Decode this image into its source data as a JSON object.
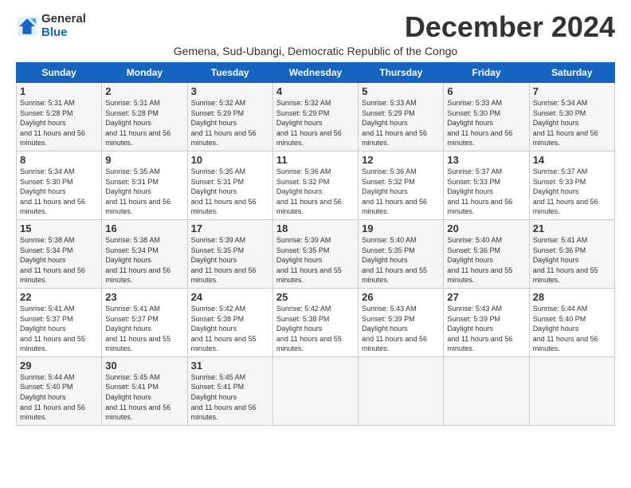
{
  "logo": {
    "line1": "General",
    "line2": "Blue"
  },
  "title": "December 2024",
  "subtitle": "Gemena, Sud-Ubangi, Democratic Republic of the Congo",
  "days_header": [
    "Sunday",
    "Monday",
    "Tuesday",
    "Wednesday",
    "Thursday",
    "Friday",
    "Saturday"
  ],
  "weeks": [
    [
      {
        "day": "1",
        "sunrise": "5:31 AM",
        "sunset": "5:28 PM",
        "daylight": "11 hours and 56 minutes."
      },
      {
        "day": "2",
        "sunrise": "5:31 AM",
        "sunset": "5:28 PM",
        "daylight": "11 hours and 56 minutes."
      },
      {
        "day": "3",
        "sunrise": "5:32 AM",
        "sunset": "5:29 PM",
        "daylight": "11 hours and 56 minutes."
      },
      {
        "day": "4",
        "sunrise": "5:32 AM",
        "sunset": "5:29 PM",
        "daylight": "11 hours and 56 minutes."
      },
      {
        "day": "5",
        "sunrise": "5:33 AM",
        "sunset": "5:29 PM",
        "daylight": "11 hours and 56 minutes."
      },
      {
        "day": "6",
        "sunrise": "5:33 AM",
        "sunset": "5:30 PM",
        "daylight": "11 hours and 56 minutes."
      },
      {
        "day": "7",
        "sunrise": "5:34 AM",
        "sunset": "5:30 PM",
        "daylight": "11 hours and 56 minutes."
      }
    ],
    [
      {
        "day": "8",
        "sunrise": "5:34 AM",
        "sunset": "5:30 PM",
        "daylight": "11 hours and 56 minutes."
      },
      {
        "day": "9",
        "sunrise": "5:35 AM",
        "sunset": "5:31 PM",
        "daylight": "11 hours and 56 minutes."
      },
      {
        "day": "10",
        "sunrise": "5:35 AM",
        "sunset": "5:31 PM",
        "daylight": "11 hours and 56 minutes."
      },
      {
        "day": "11",
        "sunrise": "5:36 AM",
        "sunset": "5:32 PM",
        "daylight": "11 hours and 56 minutes."
      },
      {
        "day": "12",
        "sunrise": "5:36 AM",
        "sunset": "5:32 PM",
        "daylight": "11 hours and 56 minutes."
      },
      {
        "day": "13",
        "sunrise": "5:37 AM",
        "sunset": "5:33 PM",
        "daylight": "11 hours and 56 minutes."
      },
      {
        "day": "14",
        "sunrise": "5:37 AM",
        "sunset": "5:33 PM",
        "daylight": "11 hours and 56 minutes."
      }
    ],
    [
      {
        "day": "15",
        "sunrise": "5:38 AM",
        "sunset": "5:34 PM",
        "daylight": "11 hours and 56 minutes."
      },
      {
        "day": "16",
        "sunrise": "5:38 AM",
        "sunset": "5:34 PM",
        "daylight": "11 hours and 56 minutes."
      },
      {
        "day": "17",
        "sunrise": "5:39 AM",
        "sunset": "5:35 PM",
        "daylight": "11 hours and 56 minutes."
      },
      {
        "day": "18",
        "sunrise": "5:39 AM",
        "sunset": "5:35 PM",
        "daylight": "11 hours and 55 minutes."
      },
      {
        "day": "19",
        "sunrise": "5:40 AM",
        "sunset": "5:35 PM",
        "daylight": "11 hours and 55 minutes."
      },
      {
        "day": "20",
        "sunrise": "5:40 AM",
        "sunset": "5:36 PM",
        "daylight": "11 hours and 55 minutes."
      },
      {
        "day": "21",
        "sunrise": "5:41 AM",
        "sunset": "5:36 PM",
        "daylight": "11 hours and 55 minutes."
      }
    ],
    [
      {
        "day": "22",
        "sunrise": "5:41 AM",
        "sunset": "5:37 PM",
        "daylight": "11 hours and 55 minutes."
      },
      {
        "day": "23",
        "sunrise": "5:41 AM",
        "sunset": "5:37 PM",
        "daylight": "11 hours and 55 minutes."
      },
      {
        "day": "24",
        "sunrise": "5:42 AM",
        "sunset": "5:38 PM",
        "daylight": "11 hours and 55 minutes."
      },
      {
        "day": "25",
        "sunrise": "5:42 AM",
        "sunset": "5:38 PM",
        "daylight": "11 hours and 55 minutes."
      },
      {
        "day": "26",
        "sunrise": "5:43 AM",
        "sunset": "5:39 PM",
        "daylight": "11 hours and 56 minutes."
      },
      {
        "day": "27",
        "sunrise": "5:43 AM",
        "sunset": "5:39 PM",
        "daylight": "11 hours and 56 minutes."
      },
      {
        "day": "28",
        "sunrise": "5:44 AM",
        "sunset": "5:40 PM",
        "daylight": "11 hours and 56 minutes."
      }
    ],
    [
      {
        "day": "29",
        "sunrise": "5:44 AM",
        "sunset": "5:40 PM",
        "daylight": "11 hours and 56 minutes."
      },
      {
        "day": "30",
        "sunrise": "5:45 AM",
        "sunset": "5:41 PM",
        "daylight": "11 hours and 56 minutes."
      },
      {
        "day": "31",
        "sunrise": "5:45 AM",
        "sunset": "5:41 PM",
        "daylight": "11 hours and 56 minutes."
      },
      null,
      null,
      null,
      null
    ]
  ]
}
